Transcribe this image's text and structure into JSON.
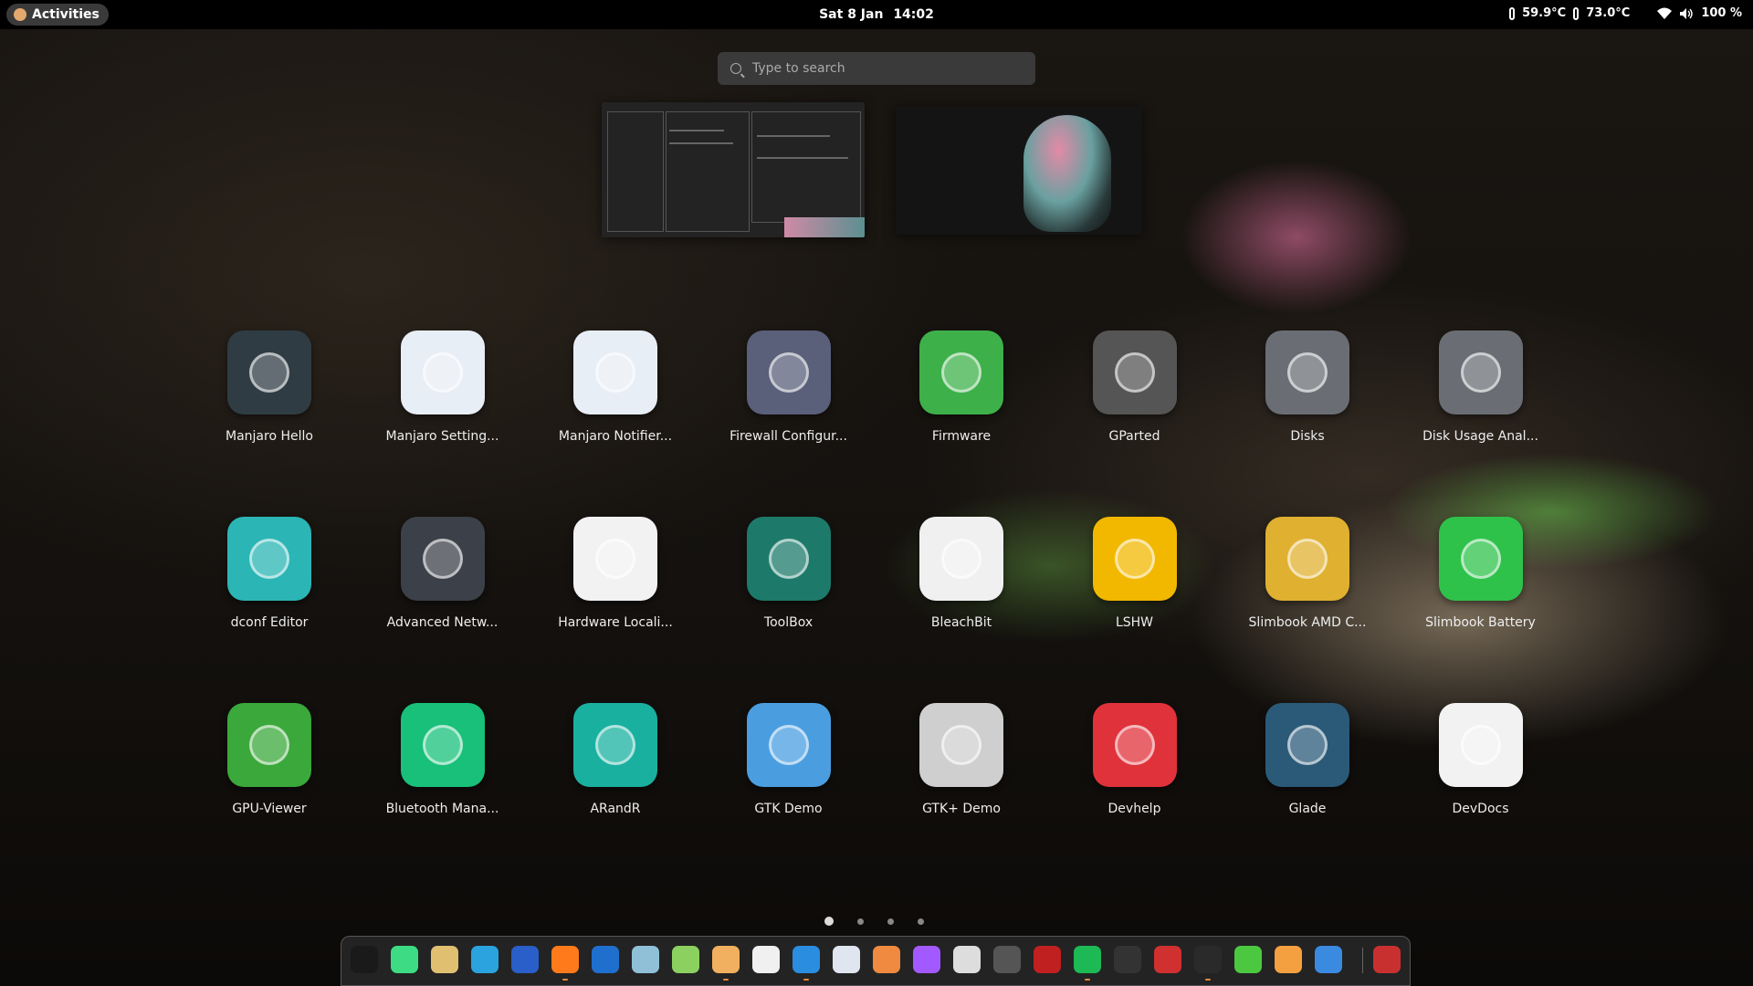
{
  "topbar": {
    "activities_label": "Activities",
    "date": "Sat 8 Jan",
    "time": "14:02",
    "temp1": "59.9°C",
    "temp2": "73.0°C",
    "battery": "100 %"
  },
  "search": {
    "placeholder": "Type to search"
  },
  "apps": [
    {
      "label": "Manjaro Hello",
      "icon": "manjaro-logo-icon",
      "color": "#2f3c44"
    },
    {
      "label": "Manjaro Setting...",
      "icon": "gear-icon",
      "color": "#e8eef5"
    },
    {
      "label": "Manjaro Notifier...",
      "icon": "gear-icon",
      "color": "#e8eef5"
    },
    {
      "label": "Firewall Configur...",
      "icon": "shield-star-icon",
      "color": "#5a5f7a"
    },
    {
      "label": "Firmware",
      "icon": "chip-board-icon",
      "color": "#3eb04a"
    },
    {
      "label": "GParted",
      "icon": "pie-disk-icon",
      "color": "#555555"
    },
    {
      "label": "Disks",
      "icon": "harddisk-gear-icon",
      "color": "#6a6e74"
    },
    {
      "label": "Disk Usage Anal...",
      "icon": "harddisk-info-icon",
      "color": "#6a6e74"
    },
    {
      "label": "dconf Editor",
      "icon": "magnifier-icon",
      "color": "#2bb5b5"
    },
    {
      "label": "Advanced Netw...",
      "icon": "ethernet-port-icon",
      "color": "#3c4048"
    },
    {
      "label": "Hardware Locali...",
      "icon": "gear-outline-icon",
      "color": "#f2f2f2"
    },
    {
      "label": "ToolBox",
      "icon": "toolbox-icon",
      "color": "#1d7a6a"
    },
    {
      "label": "BleachBit",
      "icon": "recycle-icon",
      "color": "#f0f0f0"
    },
    {
      "label": "LSHW",
      "icon": "stethoscope-icon",
      "color": "#f2b800"
    },
    {
      "label": "Slimbook AMD C...",
      "icon": "amd-icon",
      "color": "#e0b030"
    },
    {
      "label": "Slimbook Battery",
      "icon": "bolt-icon",
      "color": "#2ec24a"
    },
    {
      "label": "GPU-Viewer",
      "icon": "gpu-card-icon",
      "color": "#3aa83a"
    },
    {
      "label": "Bluetooth Mana...",
      "icon": "bluetooth-icon",
      "color": "#18c07a"
    },
    {
      "label": "ARandR",
      "icon": "monitor-icon",
      "color": "#1ab0a0"
    },
    {
      "label": "GTK Demo",
      "icon": "gtk-cube-icon",
      "color": "#4a9ee0"
    },
    {
      "label": "GTK+ Demo",
      "icon": "gtk-plus-cube-icon",
      "color": "#cfcfcf"
    },
    {
      "label": "Devhelp",
      "icon": "devhelp-book-icon",
      "color": "#e0323a"
    },
    {
      "label": "Glade",
      "icon": "glade-icon",
      "color": "#2a5a78"
    },
    {
      "label": "DevDocs",
      "icon": "gear-outline-icon",
      "color": "#f2f2f2"
    }
  ],
  "pages": {
    "count": 4,
    "current": 1
  },
  "dock": [
    {
      "name": "app-launcher-icon",
      "color": "#1a1a1a",
      "running": false
    },
    {
      "name": "android-studio-icon",
      "color": "#3ddc84",
      "running": false
    },
    {
      "name": "file-manager-icon",
      "color": "#e0c070",
      "running": false
    },
    {
      "name": "telegram-icon",
      "color": "#2aa3de",
      "running": false
    },
    {
      "name": "mail-icon",
      "color": "#2a5ec8",
      "running": false
    },
    {
      "name": "firefox-icon",
      "color": "#ff7a1a",
      "running": true
    },
    {
      "name": "vscode-icon",
      "color": "#1f6fcf",
      "running": false
    },
    {
      "name": "gtk-icon",
      "color": "#8fc0d8",
      "running": false
    },
    {
      "name": "inkscape-icon",
      "color": "#8cd060",
      "running": false
    },
    {
      "name": "text-editor-icon",
      "color": "#f0b060",
      "running": true
    },
    {
      "name": "color-picker-icon",
      "color": "#f0f0f0",
      "running": false
    },
    {
      "name": "terminal-window-icon",
      "color": "#2a8de0",
      "running": true
    },
    {
      "name": "settings-window-icon",
      "color": "#e0e6f0",
      "running": false
    },
    {
      "name": "gimp-icon",
      "color": "#f08a40",
      "running": false
    },
    {
      "name": "figma-icon",
      "color": "#a259ff",
      "running": false
    },
    {
      "name": "cat-icon",
      "color": "#dddddd",
      "running": false
    },
    {
      "name": "github-icon",
      "color": "#555555",
      "running": false
    },
    {
      "name": "grub-icon",
      "color": "#c02020",
      "running": false
    },
    {
      "name": "spotify-icon",
      "color": "#1db954",
      "running": true
    },
    {
      "name": "screenshot-icon",
      "color": "#333333",
      "running": false
    },
    {
      "name": "audio-icon",
      "color": "#d03030",
      "running": false
    },
    {
      "name": "console-icon",
      "color": "#2a2a2a",
      "running": true
    },
    {
      "name": "extensions-icon",
      "color": "#4cc840",
      "running": false
    },
    {
      "name": "software-icon",
      "color": "#f5a040",
      "running": false
    },
    {
      "name": "preferences-icon",
      "color": "#3a8ae0",
      "running": false
    },
    {
      "name": "trash-icon",
      "color": "#c83030",
      "running": false
    }
  ]
}
